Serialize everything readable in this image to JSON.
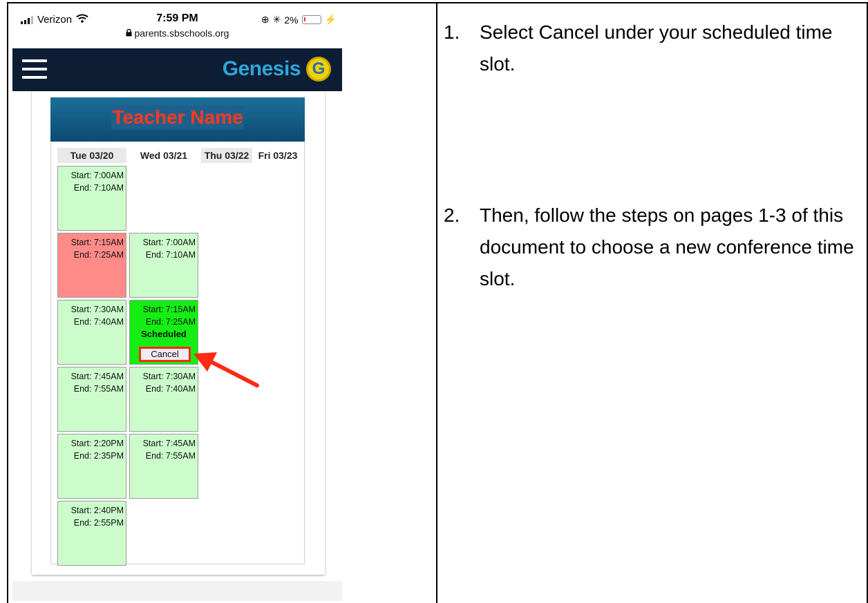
{
  "phone": {
    "status_bar": {
      "carrier": "Verizon",
      "time": "7:59 PM",
      "url": "parents.sbschools.org",
      "battery": "2%"
    },
    "nav": {
      "brand_text": "Genesis",
      "brand_logo_letter": "G"
    },
    "teacher_name": "Teacher Name",
    "days": [
      {
        "label": "Tue 03/20"
      },
      {
        "label": "Wed 03/21"
      },
      {
        "label": "Thu 03/22"
      },
      {
        "label": "Fri 03/23"
      }
    ],
    "slots": {
      "tue": [
        {
          "start": "Start:  7:00AM",
          "end": "End:  7:10AM",
          "status": "available"
        },
        {
          "start": "Start:  7:15AM",
          "end": "End:  7:25AM",
          "status": "taken"
        },
        {
          "start": "Start:  7:30AM",
          "end": "End:  7:40AM",
          "status": "available"
        },
        {
          "start": "Start:  7:45AM",
          "end": "End:  7:55AM",
          "status": "available"
        },
        {
          "start": "Start:  2:20PM",
          "end": "End:  2:35PM",
          "status": "available"
        },
        {
          "start": "Start:  2:40PM",
          "end": "End:  2:55PM",
          "status": "available"
        }
      ],
      "wed": [
        {
          "start": "Start:  7:00AM",
          "end": "End:  7:10AM",
          "status": "available"
        },
        {
          "start": "Start:  7:15AM",
          "end": "End:  7:25AM",
          "status": "scheduled",
          "label": "Scheduled",
          "button": "Cancel"
        },
        {
          "start": "Start:  7:30AM",
          "end": "End:  7:40AM",
          "status": "available"
        },
        {
          "start": "Start:  7:45AM",
          "end": "End:  7:55AM",
          "status": "available"
        }
      ]
    },
    "colors": {
      "available": "#ccfccc",
      "taken": "#ff8b88",
      "scheduled": "#14ee14",
      "highlight": "#ff2a12"
    }
  },
  "instructions": [
    {
      "number": "1.",
      "text": "Select Cancel under your scheduled time slot."
    },
    {
      "number": "2.",
      "text": "Then, follow the steps on pages 1-3 of this document to choose a new conference time slot."
    }
  ]
}
